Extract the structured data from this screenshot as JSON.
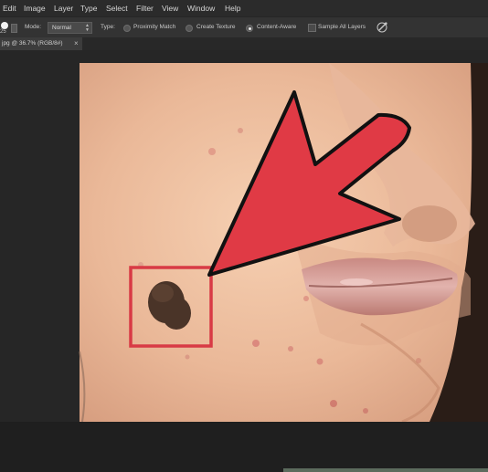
{
  "menu": {
    "items": [
      "Edit",
      "Image",
      "Layer",
      "Type",
      "Select",
      "Filter",
      "View",
      "Window",
      "Help"
    ]
  },
  "options": {
    "brush_size": "25",
    "mode_label": "Mode:",
    "mode_value": "Normal",
    "type_label": "Type:",
    "type_options": [
      "Proximity Match",
      "Create Texture",
      "Content-Aware"
    ],
    "type_selected": "Content-Aware",
    "sample_all_layers_label": "Sample All Layers",
    "sample_all_layers_checked": false
  },
  "document": {
    "tab_title": "jpg @ 36.7% (RGB/8#)",
    "close_symbol": "×"
  },
  "annotation": {
    "arrow_color": "#e03a45",
    "box_color": "#d83a45"
  }
}
